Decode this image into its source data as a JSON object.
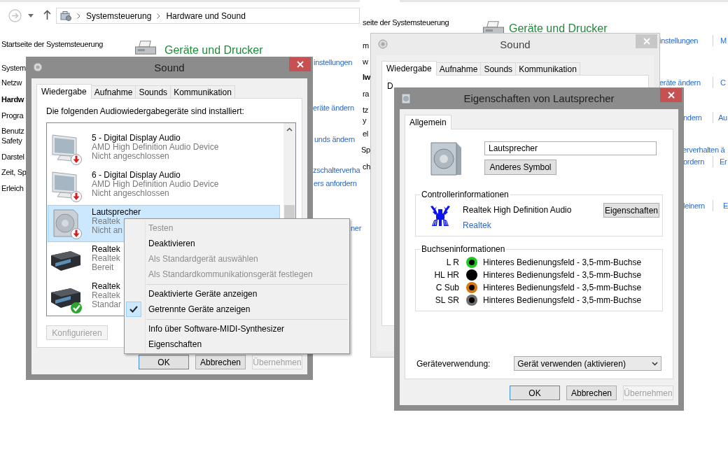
{
  "left_screen": {
    "address_bar": {
      "crumbs": [
        "Systemsteuerung",
        "Hardware und Sound"
      ]
    },
    "nav_links": [
      {
        "text": "Startseite der Systemsteuerung",
        "selected": false
      },
      {
        "text": "System",
        "selected": false
      },
      {
        "text": "Netzw",
        "selected": false
      },
      {
        "text": "Hardw",
        "selected": true
      },
      {
        "text": "Progra",
        "selected": false
      },
      {
        "text": "Benutz",
        "selected": false
      },
      {
        "text": "Safety",
        "selected": false
      },
      {
        "text": "Darstel",
        "selected": false
      },
      {
        "text": "Zeit, Sp",
        "selected": false
      },
      {
        "text": "Erleich",
        "selected": false
      }
    ],
    "heading": "Geräte und Drucker",
    "links": [
      "instellungen",
      "eräte ändern",
      "unds ändern",
      "zschalterverha",
      "ers anfordern",
      "ner"
    ],
    "sound_dialog": {
      "title": "Sound",
      "active": true,
      "tabs": [
        {
          "label": "Wiedergabe",
          "selected": true
        },
        {
          "label": "Aufnahme",
          "selected": false
        },
        {
          "label": "Sounds",
          "selected": false
        },
        {
          "label": "Kommunikation",
          "selected": false
        }
      ],
      "prompt": "Die folgenden Audiowiedergabegeräte sind installiert:",
      "devices": [
        {
          "name": "5 - Digital Display Audio",
          "driver": "AMD High Definition Audio Device",
          "status": "Nicht angeschlossen",
          "kind": "monitor",
          "unplugged": true,
          "default": false,
          "selected": false
        },
        {
          "name": "6 - Digital Display Audio",
          "driver": "AMD High Definition Audio Device",
          "status": "Nicht angeschlossen",
          "kind": "monitor",
          "unplugged": true,
          "default": false,
          "selected": false
        },
        {
          "name": "Lautsprecher",
          "driver": "Realtek",
          "status": "Nicht an",
          "kind": "speaker",
          "unplugged": true,
          "default": false,
          "selected": true
        },
        {
          "name": "Realtek",
          "driver": "Realtek",
          "status": "Bereit",
          "kind": "receiver",
          "unplugged": false,
          "default": false,
          "selected": false
        },
        {
          "name": "Realtek",
          "driver": "Realtek",
          "status": "Standar",
          "kind": "receiver",
          "unplugged": false,
          "default": true,
          "selected": false
        }
      ],
      "configure_button": {
        "label": "Konfigurieren",
        "disabled": true
      },
      "footer_buttons": [
        {
          "label": "OK",
          "default": true,
          "disabled": false
        },
        {
          "label": "Abbrechen",
          "default": false,
          "disabled": false
        },
        {
          "label": "Übernehmen",
          "default": false,
          "disabled": true
        }
      ]
    },
    "context_menu": {
      "groups": [
        [
          {
            "label": "Testen",
            "disabled": true,
            "checked": false
          },
          {
            "label": "Deaktivieren",
            "disabled": false,
            "checked": false
          },
          {
            "label": "Als Standardgerät auswählen",
            "disabled": true,
            "checked": false
          },
          {
            "label": "Als Standardkommunikationsgerät festlegen",
            "disabled": true,
            "checked": false
          }
        ],
        [
          {
            "label": "Deaktivierte Geräte anzeigen",
            "disabled": false,
            "checked": false
          },
          {
            "label": "Getrennte Geräte anzeigen",
            "disabled": false,
            "checked": true
          }
        ],
        [
          {
            "label": "Info über Software-MIDI-Synthesizer",
            "disabled": false,
            "checked": false
          },
          {
            "label": "Eigenschaften",
            "disabled": false,
            "checked": false
          }
        ]
      ]
    }
  },
  "right_screen": {
    "nav_links": [
      {
        "text": "seite der Systemsteuerung",
        "selected": false
      },
      {
        "text": "m",
        "selected": false
      },
      {
        "text": "w",
        "selected": false
      },
      {
        "text": "lw",
        "selected": true
      },
      {
        "text": "ra",
        "selected": false
      },
      {
        "text": "tz",
        "selected": false
      },
      {
        "text": "y",
        "selected": false
      },
      {
        "text": "el",
        "selected": false
      },
      {
        "text": "Sp",
        "selected": false
      },
      {
        "text": "ch",
        "selected": false
      }
    ],
    "heading": "Geräte und Drucker",
    "links": [
      {
        "text": "instellungen",
        "extra": "M"
      },
      {
        "text": "eräte ändern",
        "extra": "C"
      },
      {
        "text": "ndern",
        "extra": "Au"
      },
      {
        "text": "erverhalten ä"
      },
      {
        "text": "ordern",
        "extra": "Er"
      },
      {
        "text": "leinern",
        "extra": "E"
      }
    ],
    "sound_dialog": {
      "title": "Sound",
      "active": false,
      "tabs": [
        {
          "label": "Wiedergabe",
          "selected": true
        },
        {
          "label": "Aufnahme",
          "selected": false
        },
        {
          "label": "Sounds",
          "selected": false
        },
        {
          "label": "Kommunikation",
          "selected": false
        }
      ],
      "prompt": "D"
    },
    "properties_dialog": {
      "title": "Eigenschaften von Lautsprecher",
      "active": true,
      "tabs": [
        {
          "label": "Allgemein",
          "selected": true
        }
      ],
      "name_value": "Lautsprecher",
      "change_icon_button": {
        "label": "Anderes Symbol"
      },
      "controller": {
        "title": "Controllerinformationen",
        "name": "Realtek High Definition Audio",
        "link": "Realtek",
        "button": {
          "label": "Eigenschaften"
        }
      },
      "jacks": {
        "title": "Buchseninformationen",
        "rows": [
          {
            "channel": "L R",
            "color": "#1ec81e",
            "location": "Hinteres Bedienungsfeld - 3,5-mm-Buchse"
          },
          {
            "channel": "HL HR",
            "color": "#000000",
            "location": "Hinteres Bedienungsfeld - 3,5-mm-Buchse"
          },
          {
            "channel": "C Sub",
            "color": "#d9770f",
            "location": "Hinteres Bedienungsfeld - 3,5-mm-Buchse"
          },
          {
            "channel": "SL SR",
            "color": "#6e6e6e",
            "location": "Hinteres Bedienungsfeld - 3,5-mm-Buchse"
          }
        ]
      },
      "usage": {
        "label": "Geräteverwendung:",
        "value": "Gerät verwenden (aktivieren)"
      },
      "footer_buttons": [
        {
          "label": "OK",
          "default": true,
          "disabled": false
        },
        {
          "label": "Abbrechen",
          "default": false,
          "disabled": false
        },
        {
          "label": "Übernehmen",
          "default": false,
          "disabled": true
        }
      ]
    }
  }
}
